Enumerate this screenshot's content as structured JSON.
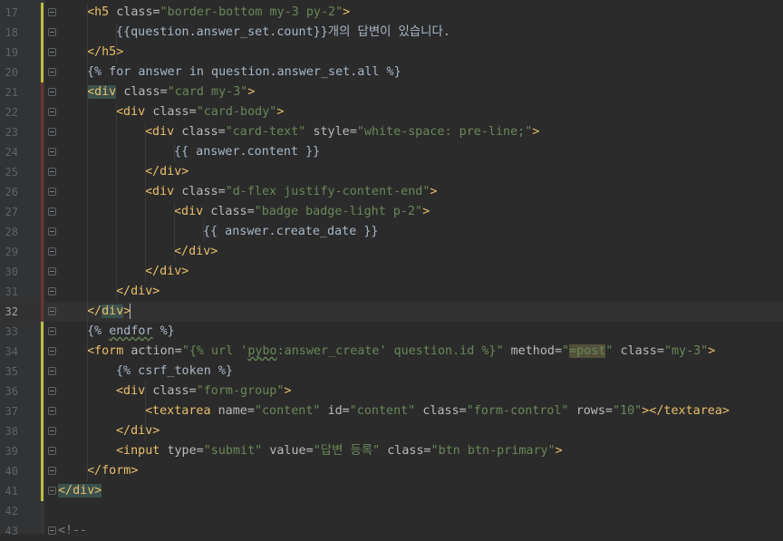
{
  "editor": {
    "current_line": 32,
    "lines": [
      {
        "num": "17",
        "indent": 3,
        "tokens": [
          {
            "t": "<",
            "c": "t-tag"
          },
          {
            "t": "h5",
            "c": "t-tag"
          },
          {
            "t": " ",
            "c": "t-plain"
          },
          {
            "t": "class=",
            "c": "t-attr"
          },
          {
            "t": "\"border-bottom my-3 py-2\"",
            "c": "t-str"
          },
          {
            "t": ">",
            "c": "t-tag"
          }
        ]
      },
      {
        "num": "18",
        "indent": 4,
        "tokens": [
          {
            "t": "{{question.answer_set.count}}개의 답변이 있습니다.",
            "c": "t-tpl"
          }
        ]
      },
      {
        "num": "19",
        "indent": 3,
        "tokens": [
          {
            "t": "</h5>",
            "c": "t-tag"
          }
        ]
      },
      {
        "num": "20",
        "indent": 3,
        "tokens": [
          {
            "t": "{% for answer in question.answer_set.all %}",
            "c": "t-tpl"
          }
        ]
      },
      {
        "num": "21",
        "indent": 3,
        "tokens": [
          {
            "t": "<",
            "c": "t-tag hl-tag"
          },
          {
            "t": "div",
            "c": "t-tag hl-tag"
          },
          {
            "t": " ",
            "c": "t-plain"
          },
          {
            "t": "class=",
            "c": "t-attr"
          },
          {
            "t": "\"card my-3\"",
            "c": "t-str"
          },
          {
            "t": ">",
            "c": "t-tag"
          }
        ]
      },
      {
        "num": "22",
        "indent": 4,
        "tokens": [
          {
            "t": "<div",
            "c": "t-tag"
          },
          {
            "t": " ",
            "c": "t-plain"
          },
          {
            "t": "class=",
            "c": "t-attr"
          },
          {
            "t": "\"card-body\"",
            "c": "t-str"
          },
          {
            "t": ">",
            "c": "t-tag"
          }
        ]
      },
      {
        "num": "23",
        "indent": 5,
        "tokens": [
          {
            "t": "<div",
            "c": "t-tag"
          },
          {
            "t": " ",
            "c": "t-plain"
          },
          {
            "t": "class=",
            "c": "t-attr"
          },
          {
            "t": "\"card-text\"",
            "c": "t-str"
          },
          {
            "t": " ",
            "c": "t-plain"
          },
          {
            "t": "style=",
            "c": "t-attr"
          },
          {
            "t": "\"white-space: pre-line;\"",
            "c": "t-str"
          },
          {
            "t": ">",
            "c": "t-tag"
          }
        ]
      },
      {
        "num": "24",
        "indent": 6,
        "tokens": [
          {
            "t": "{{ answer.content }}",
            "c": "t-tpl"
          }
        ]
      },
      {
        "num": "25",
        "indent": 5,
        "tokens": [
          {
            "t": "</div>",
            "c": "t-tag"
          }
        ]
      },
      {
        "num": "26",
        "indent": 5,
        "tokens": [
          {
            "t": "<div",
            "c": "t-tag"
          },
          {
            "t": " ",
            "c": "t-plain"
          },
          {
            "t": "class=",
            "c": "t-attr"
          },
          {
            "t": "\"d-flex justify-content-end\"",
            "c": "t-str"
          },
          {
            "t": ">",
            "c": "t-tag"
          }
        ]
      },
      {
        "num": "27",
        "indent": 6,
        "tokens": [
          {
            "t": "<div",
            "c": "t-tag"
          },
          {
            "t": " ",
            "c": "t-plain"
          },
          {
            "t": "class=",
            "c": "t-attr"
          },
          {
            "t": "\"badge badge-light p-2\"",
            "c": "t-str"
          },
          {
            "t": ">",
            "c": "t-tag"
          }
        ]
      },
      {
        "num": "28",
        "indent": 7,
        "tokens": [
          {
            "t": "{{ answer.create_date }}",
            "c": "t-tpl"
          }
        ]
      },
      {
        "num": "29",
        "indent": 6,
        "tokens": [
          {
            "t": "</div>",
            "c": "t-tag"
          }
        ]
      },
      {
        "num": "30",
        "indent": 5,
        "tokens": [
          {
            "t": "</div>",
            "c": "t-tag"
          }
        ]
      },
      {
        "num": "31",
        "indent": 4,
        "tokens": [
          {
            "t": "</div>",
            "c": "t-tag"
          }
        ]
      },
      {
        "num": "32",
        "indent": 3,
        "tokens": [
          {
            "t": "</",
            "c": "t-tag"
          },
          {
            "t": "div",
            "c": "t-tag hl-tag"
          },
          {
            "t": ">",
            "c": "t-tag"
          },
          {
            "t": "",
            "c": "caret"
          }
        ]
      },
      {
        "num": "33",
        "indent": 3,
        "tokens": [
          {
            "t": "{% ",
            "c": "t-tpl"
          },
          {
            "t": "endfor",
            "c": "t-tpl wavy"
          },
          {
            "t": " %}",
            "c": "t-tpl"
          }
        ]
      },
      {
        "num": "34",
        "indent": 3,
        "tokens": [
          {
            "t": "<form",
            "c": "t-tag"
          },
          {
            "t": " ",
            "c": "t-plain"
          },
          {
            "t": "action=",
            "c": "t-attr"
          },
          {
            "t": "\"{% url '",
            "c": "t-str"
          },
          {
            "t": "pybo",
            "c": "t-str wavy"
          },
          {
            "t": ":answer_create' question.id %}\"",
            "c": "t-str"
          },
          {
            "t": " ",
            "c": "t-plain"
          },
          {
            "t": "method=",
            "c": "t-attr"
          },
          {
            "t": "\"",
            "c": "t-str"
          },
          {
            "t": "=post",
            "c": "t-str hl-sel"
          },
          {
            "t": "\"",
            "c": "t-str"
          },
          {
            "t": " ",
            "c": "t-plain"
          },
          {
            "t": "class=",
            "c": "t-attr"
          },
          {
            "t": "\"my-3\"",
            "c": "t-str"
          },
          {
            "t": ">",
            "c": "t-tag"
          }
        ]
      },
      {
        "num": "35",
        "indent": 4,
        "tokens": [
          {
            "t": "{% csrf_token %}",
            "c": "t-tpl"
          }
        ]
      },
      {
        "num": "36",
        "indent": 4,
        "tokens": [
          {
            "t": "<div",
            "c": "t-tag"
          },
          {
            "t": " ",
            "c": "t-plain"
          },
          {
            "t": "class=",
            "c": "t-attr"
          },
          {
            "t": "\"form-group\"",
            "c": "t-str"
          },
          {
            "t": ">",
            "c": "t-tag"
          }
        ]
      },
      {
        "num": "37",
        "indent": 5,
        "tokens": [
          {
            "t": "<textarea",
            "c": "t-tag"
          },
          {
            "t": " ",
            "c": "t-plain"
          },
          {
            "t": "name=",
            "c": "t-attr"
          },
          {
            "t": "\"content\"",
            "c": "t-str"
          },
          {
            "t": " ",
            "c": "t-plain"
          },
          {
            "t": "id=",
            "c": "t-attr"
          },
          {
            "t": "\"content\"",
            "c": "t-str"
          },
          {
            "t": " ",
            "c": "t-plain"
          },
          {
            "t": "class=",
            "c": "t-attr"
          },
          {
            "t": "\"form-control\"",
            "c": "t-str"
          },
          {
            "t": " ",
            "c": "t-plain"
          },
          {
            "t": "rows=",
            "c": "t-attr"
          },
          {
            "t": "\"10\"",
            "c": "t-str"
          },
          {
            "t": "></textarea>",
            "c": "t-tag"
          }
        ]
      },
      {
        "num": "38",
        "indent": 4,
        "tokens": [
          {
            "t": "</div>",
            "c": "t-tag"
          }
        ]
      },
      {
        "num": "39",
        "indent": 4,
        "tokens": [
          {
            "t": "<input",
            "c": "t-tag"
          },
          {
            "t": " ",
            "c": "t-plain"
          },
          {
            "t": "type=",
            "c": "t-attr"
          },
          {
            "t": "\"submit\"",
            "c": "t-str"
          },
          {
            "t": " ",
            "c": "t-plain"
          },
          {
            "t": "value=",
            "c": "t-attr"
          },
          {
            "t": "\"답변 등록\"",
            "c": "t-str"
          },
          {
            "t": " ",
            "c": "t-plain"
          },
          {
            "t": "class=",
            "c": "t-attr"
          },
          {
            "t": "\"btn btn-primary\"",
            "c": "t-str"
          },
          {
            "t": ">",
            "c": "t-tag"
          }
        ]
      },
      {
        "num": "40",
        "indent": 3,
        "tokens": [
          {
            "t": "</form>",
            "c": "t-tag"
          }
        ]
      },
      {
        "num": "41",
        "indent": 2,
        "tokens": [
          {
            "t": "</div>",
            "c": "t-tag hl-match"
          }
        ]
      },
      {
        "num": "42",
        "indent": 0,
        "tokens": []
      },
      {
        "num": "43",
        "indent": 2,
        "tokens": [
          {
            "t": "<!--",
            "c": "t-cm"
          }
        ]
      }
    ]
  }
}
